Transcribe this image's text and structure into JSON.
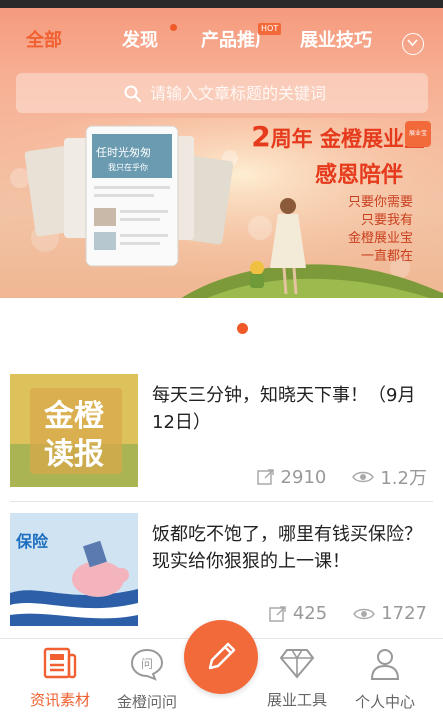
{
  "tabs": [
    {
      "label": "全部"
    },
    {
      "label": "发现"
    },
    {
      "label": "产品推广",
      "badge": "HOT"
    },
    {
      "label": "展业技巧"
    }
  ],
  "search": {
    "placeholder": "请输入文章标题的关键词"
  },
  "banner": {
    "anniv_num": "2",
    "anniv_text": "周年 金橙展业宝",
    "title": "感恩陪伴",
    "lines": [
      "只要你需要",
      "只要我有",
      "金橙展业宝",
      "一直都在"
    ],
    "logo_text": "展业宝",
    "phone_title": "任时光匆匆",
    "phone_sub": "我只在乎你"
  },
  "articles": [
    {
      "title": "每天三分钟，知晓天下事！（9月12日）",
      "shares": "2910",
      "views": "1.2万",
      "thumb_text": "金橙读报"
    },
    {
      "title": "饭都吃不饱了，哪里有钱买保险？现实给你狠狠的上一课！",
      "shares": "425",
      "views": "1727",
      "thumb_text": "保险"
    }
  ],
  "nav": [
    {
      "label": "资讯素材"
    },
    {
      "label": "金橙问问",
      "icon_text": "问"
    },
    {
      "label": "展业工具"
    },
    {
      "label": "个人中心"
    }
  ],
  "colors": {
    "accent": "#f06030",
    "fab": "#f26a3a"
  }
}
